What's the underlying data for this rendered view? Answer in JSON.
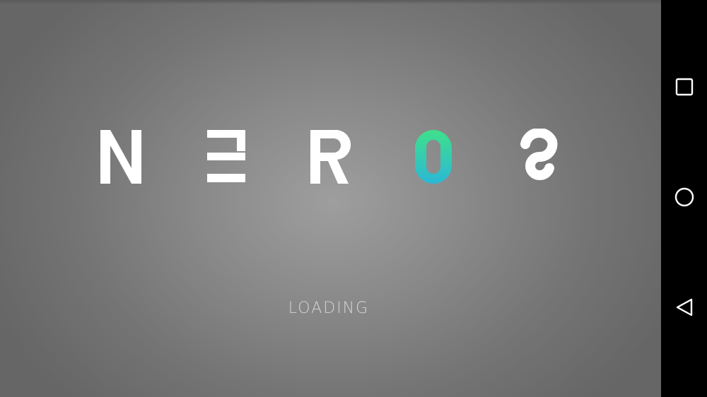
{
  "game": {
    "title_letters": [
      "N",
      "E",
      "R",
      "O",
      "S"
    ],
    "loading_text": "LOADING"
  },
  "colors": {
    "letter": "#ffffff",
    "accent_gradient_top": "#3fe08a",
    "accent_gradient_bottom": "#2bb8d6",
    "background": "#8c8c8c",
    "nav_bar": "#000000"
  },
  "nav_bar": {
    "buttons": [
      {
        "icon": "recent-apps-icon"
      },
      {
        "icon": "home-icon"
      },
      {
        "icon": "back-icon"
      }
    ]
  }
}
